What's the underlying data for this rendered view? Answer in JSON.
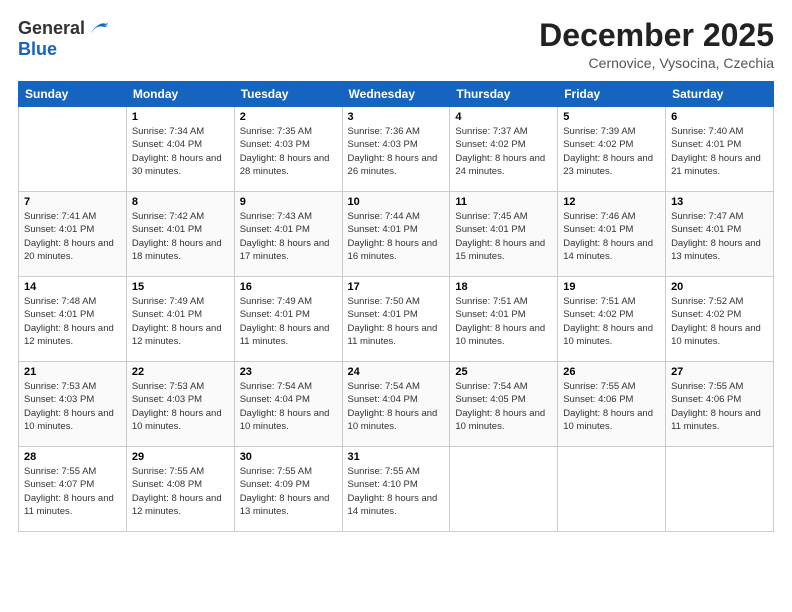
{
  "logo": {
    "general": "General",
    "blue": "Blue"
  },
  "title": "December 2025",
  "subtitle": "Cernovice, Vysocina, Czechia",
  "weekdays": [
    "Sunday",
    "Monday",
    "Tuesday",
    "Wednesday",
    "Thursday",
    "Friday",
    "Saturday"
  ],
  "weeks": [
    [
      {
        "day": "",
        "sunrise": "",
        "sunset": "",
        "daylight": ""
      },
      {
        "day": "1",
        "sunrise": "Sunrise: 7:34 AM",
        "sunset": "Sunset: 4:04 PM",
        "daylight": "Daylight: 8 hours and 30 minutes."
      },
      {
        "day": "2",
        "sunrise": "Sunrise: 7:35 AM",
        "sunset": "Sunset: 4:03 PM",
        "daylight": "Daylight: 8 hours and 28 minutes."
      },
      {
        "day": "3",
        "sunrise": "Sunrise: 7:36 AM",
        "sunset": "Sunset: 4:03 PM",
        "daylight": "Daylight: 8 hours and 26 minutes."
      },
      {
        "day": "4",
        "sunrise": "Sunrise: 7:37 AM",
        "sunset": "Sunset: 4:02 PM",
        "daylight": "Daylight: 8 hours and 24 minutes."
      },
      {
        "day": "5",
        "sunrise": "Sunrise: 7:39 AM",
        "sunset": "Sunset: 4:02 PM",
        "daylight": "Daylight: 8 hours and 23 minutes."
      },
      {
        "day": "6",
        "sunrise": "Sunrise: 7:40 AM",
        "sunset": "Sunset: 4:01 PM",
        "daylight": "Daylight: 8 hours and 21 minutes."
      }
    ],
    [
      {
        "day": "7",
        "sunrise": "Sunrise: 7:41 AM",
        "sunset": "Sunset: 4:01 PM",
        "daylight": "Daylight: 8 hours and 20 minutes."
      },
      {
        "day": "8",
        "sunrise": "Sunrise: 7:42 AM",
        "sunset": "Sunset: 4:01 PM",
        "daylight": "Daylight: 8 hours and 18 minutes."
      },
      {
        "day": "9",
        "sunrise": "Sunrise: 7:43 AM",
        "sunset": "Sunset: 4:01 PM",
        "daylight": "Daylight: 8 hours and 17 minutes."
      },
      {
        "day": "10",
        "sunrise": "Sunrise: 7:44 AM",
        "sunset": "Sunset: 4:01 PM",
        "daylight": "Daylight: 8 hours and 16 minutes."
      },
      {
        "day": "11",
        "sunrise": "Sunrise: 7:45 AM",
        "sunset": "Sunset: 4:01 PM",
        "daylight": "Daylight: 8 hours and 15 minutes."
      },
      {
        "day": "12",
        "sunrise": "Sunrise: 7:46 AM",
        "sunset": "Sunset: 4:01 PM",
        "daylight": "Daylight: 8 hours and 14 minutes."
      },
      {
        "day": "13",
        "sunrise": "Sunrise: 7:47 AM",
        "sunset": "Sunset: 4:01 PM",
        "daylight": "Daylight: 8 hours and 13 minutes."
      }
    ],
    [
      {
        "day": "14",
        "sunrise": "Sunrise: 7:48 AM",
        "sunset": "Sunset: 4:01 PM",
        "daylight": "Daylight: 8 hours and 12 minutes."
      },
      {
        "day": "15",
        "sunrise": "Sunrise: 7:49 AM",
        "sunset": "Sunset: 4:01 PM",
        "daylight": "Daylight: 8 hours and 12 minutes."
      },
      {
        "day": "16",
        "sunrise": "Sunrise: 7:49 AM",
        "sunset": "Sunset: 4:01 PM",
        "daylight": "Daylight: 8 hours and 11 minutes."
      },
      {
        "day": "17",
        "sunrise": "Sunrise: 7:50 AM",
        "sunset": "Sunset: 4:01 PM",
        "daylight": "Daylight: 8 hours and 11 minutes."
      },
      {
        "day": "18",
        "sunrise": "Sunrise: 7:51 AM",
        "sunset": "Sunset: 4:01 PM",
        "daylight": "Daylight: 8 hours and 10 minutes."
      },
      {
        "day": "19",
        "sunrise": "Sunrise: 7:51 AM",
        "sunset": "Sunset: 4:02 PM",
        "daylight": "Daylight: 8 hours and 10 minutes."
      },
      {
        "day": "20",
        "sunrise": "Sunrise: 7:52 AM",
        "sunset": "Sunset: 4:02 PM",
        "daylight": "Daylight: 8 hours and 10 minutes."
      }
    ],
    [
      {
        "day": "21",
        "sunrise": "Sunrise: 7:53 AM",
        "sunset": "Sunset: 4:03 PM",
        "daylight": "Daylight: 8 hours and 10 minutes."
      },
      {
        "day": "22",
        "sunrise": "Sunrise: 7:53 AM",
        "sunset": "Sunset: 4:03 PM",
        "daylight": "Daylight: 8 hours and 10 minutes."
      },
      {
        "day": "23",
        "sunrise": "Sunrise: 7:54 AM",
        "sunset": "Sunset: 4:04 PM",
        "daylight": "Daylight: 8 hours and 10 minutes."
      },
      {
        "day": "24",
        "sunrise": "Sunrise: 7:54 AM",
        "sunset": "Sunset: 4:04 PM",
        "daylight": "Daylight: 8 hours and 10 minutes."
      },
      {
        "day": "25",
        "sunrise": "Sunrise: 7:54 AM",
        "sunset": "Sunset: 4:05 PM",
        "daylight": "Daylight: 8 hours and 10 minutes."
      },
      {
        "day": "26",
        "sunrise": "Sunrise: 7:55 AM",
        "sunset": "Sunset: 4:06 PM",
        "daylight": "Daylight: 8 hours and 10 minutes."
      },
      {
        "day": "27",
        "sunrise": "Sunrise: 7:55 AM",
        "sunset": "Sunset: 4:06 PM",
        "daylight": "Daylight: 8 hours and 11 minutes."
      }
    ],
    [
      {
        "day": "28",
        "sunrise": "Sunrise: 7:55 AM",
        "sunset": "Sunset: 4:07 PM",
        "daylight": "Daylight: 8 hours and 11 minutes."
      },
      {
        "day": "29",
        "sunrise": "Sunrise: 7:55 AM",
        "sunset": "Sunset: 4:08 PM",
        "daylight": "Daylight: 8 hours and 12 minutes."
      },
      {
        "day": "30",
        "sunrise": "Sunrise: 7:55 AM",
        "sunset": "Sunset: 4:09 PM",
        "daylight": "Daylight: 8 hours and 13 minutes."
      },
      {
        "day": "31",
        "sunrise": "Sunrise: 7:55 AM",
        "sunset": "Sunset: 4:10 PM",
        "daylight": "Daylight: 8 hours and 14 minutes."
      },
      {
        "day": "",
        "sunrise": "",
        "sunset": "",
        "daylight": ""
      },
      {
        "day": "",
        "sunrise": "",
        "sunset": "",
        "daylight": ""
      },
      {
        "day": "",
        "sunrise": "",
        "sunset": "",
        "daylight": ""
      }
    ]
  ]
}
